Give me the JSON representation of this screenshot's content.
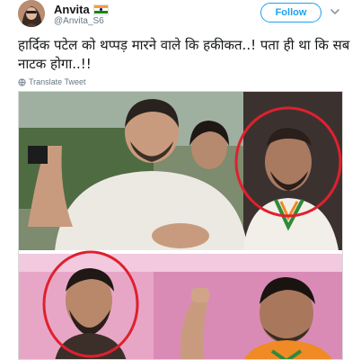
{
  "author": {
    "name": "Anvita",
    "handle": "@Anvita_S6",
    "flag_icon": "india-flag-icon"
  },
  "follow_label": "Follow",
  "tweet": {
    "text": "हार्दिक पटेल को थप्पड़ मारने वाले कि हकीकत..! पता ही था कि सब नाटक होगा..!!",
    "translate_label": "Translate Tweet"
  },
  "icons": {
    "menu": "chevron-down-icon",
    "translate": "globe-icon"
  },
  "colors": {
    "accent": "#1da1f2",
    "circle_annotation": "#e0202e",
    "secondary_text": "#657786"
  }
}
